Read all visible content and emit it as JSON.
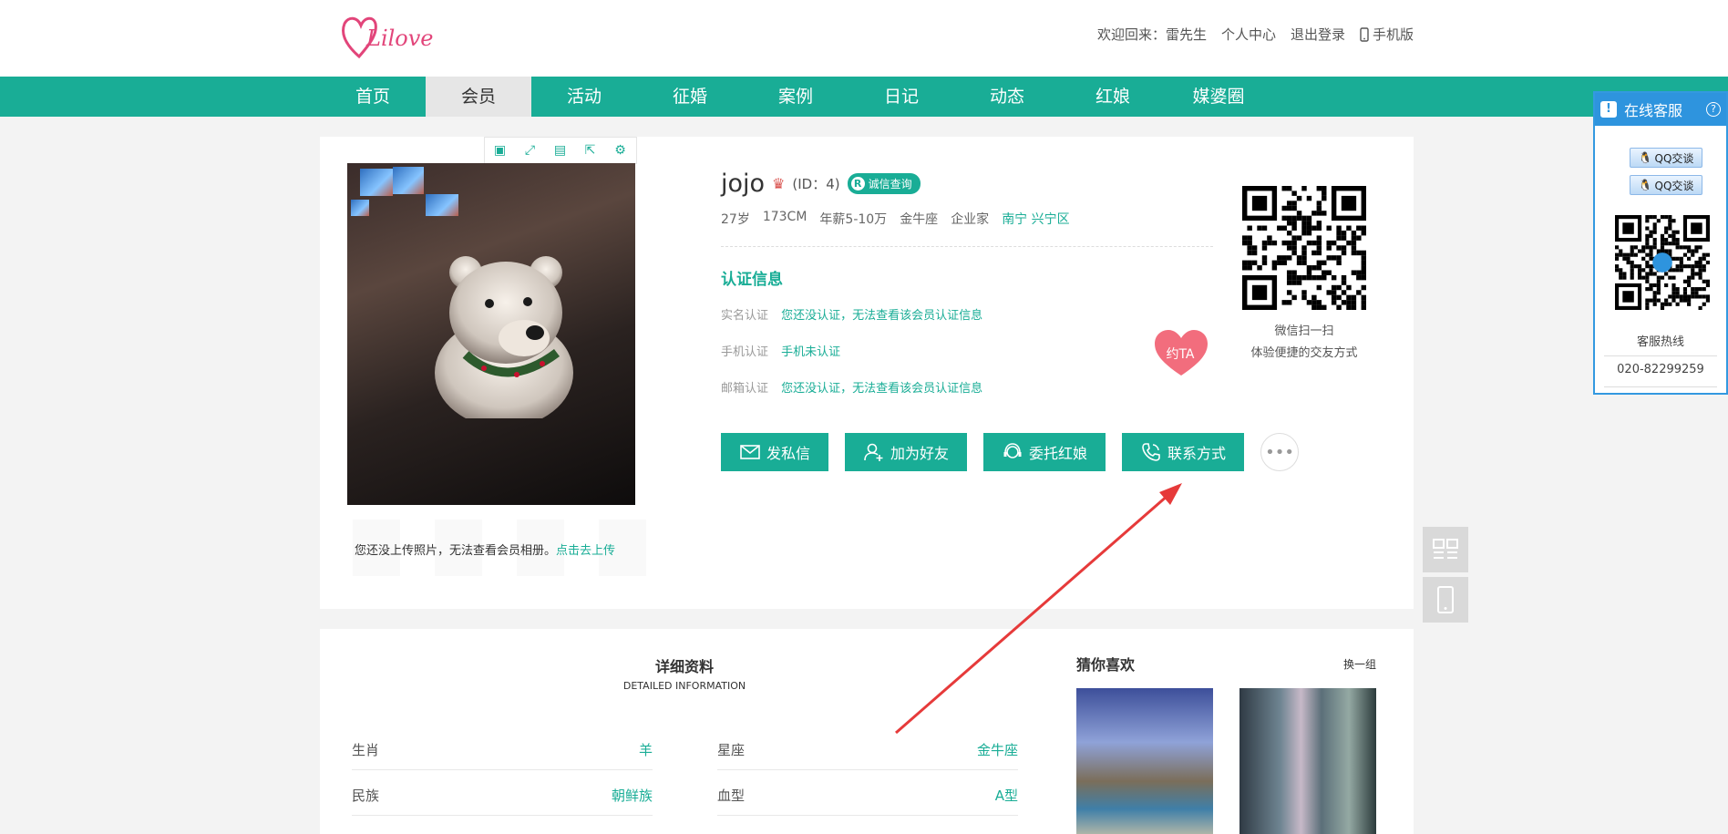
{
  "header": {
    "logo_text": "Lilove",
    "welcome": "欢迎回来：雷先生",
    "personal_center": "个人中心",
    "logout": "退出登录",
    "mobile": "手机版"
  },
  "nav": {
    "items": [
      "首页",
      "会员",
      "活动",
      "征婚",
      "案例",
      "日记",
      "动态",
      "红娘",
      "媒婆圈"
    ],
    "active_index": 1
  },
  "profile": {
    "username": "jojo",
    "id_text": "(ID：4)",
    "credit_badge": "诚信查询",
    "age": "27岁",
    "height": "173CM",
    "salary": "年薪5-10万",
    "zodiac": "金牛座",
    "job": "企业家",
    "location": "南宁 兴宁区",
    "no_photo_tip": "您还没上传照片，无法查看会员相册。",
    "upload_link": "点击去上传",
    "cert_title": "认证信息",
    "certs": [
      {
        "label": "实名认证",
        "value": "您还没认证，无法查看该会员认证信息"
      },
      {
        "label": "手机认证",
        "value": "手机未认证"
      },
      {
        "label": "邮箱认证",
        "value": "您还没认证，无法查看该会员认证信息"
      }
    ],
    "date_button": "约TA",
    "qr_line1": "微信扫一扫",
    "qr_line2": "体验便捷的交友方式",
    "actions": {
      "message": "发私信",
      "add_friend": "加为好友",
      "matchmaker": "委托红娘",
      "contact": "联系方式"
    }
  },
  "detail": {
    "title": "详细资料",
    "subtitle": "DETAILED INFORMATION",
    "rows_left": [
      {
        "label": "生肖",
        "value": "羊"
      },
      {
        "label": "民族",
        "value": "朝鲜族"
      }
    ],
    "rows_right": [
      {
        "label": "星座",
        "value": "金牛座"
      },
      {
        "label": "血型",
        "value": "A型"
      }
    ]
  },
  "guess": {
    "title": "猜你喜欢",
    "refresh": "换一组"
  },
  "service": {
    "title": "在线客服",
    "qq1": "QQ交谈",
    "qq2": "QQ交谈",
    "hotline_label": "客服热线",
    "hotline": "020-82299259"
  },
  "colors": {
    "brand": "#19ad96",
    "logo_pink": "#e2457a",
    "service_blue": "#2e94de",
    "arrow_red": "#e63a3a"
  }
}
